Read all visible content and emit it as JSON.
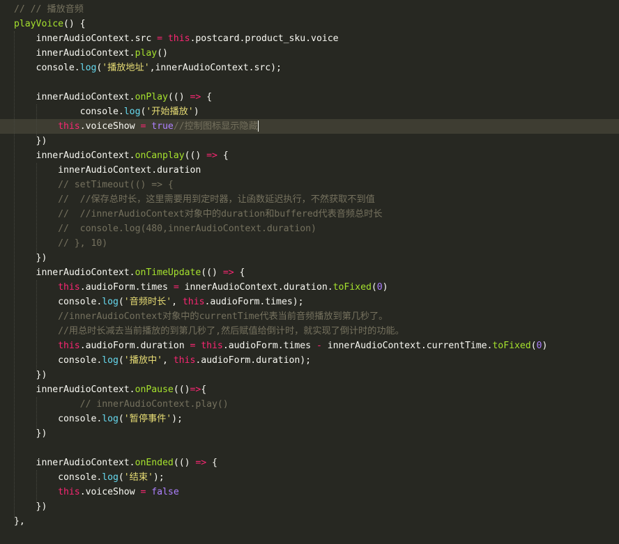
{
  "editor": {
    "cursor_after_line_index": 8,
    "highlighted_line_index": 8,
    "lines": [
      [
        [
          "cm",
          "// // 播放音频"
        ]
      ],
      [
        [
          "fn",
          "playVoice"
        ],
        [
          "pl",
          "() {"
        ]
      ],
      [
        [
          "pl",
          "    innerAudioContext.src "
        ],
        [
          "kw",
          "="
        ],
        [
          "pl",
          " "
        ],
        [
          "this",
          "this"
        ],
        [
          "pl",
          ".postcard.product_sku.voice"
        ]
      ],
      [
        [
          "pl",
          "    innerAudioContext."
        ],
        [
          "fn",
          "play"
        ],
        [
          "pl",
          "()"
        ]
      ],
      [
        [
          "pl",
          "    console."
        ],
        [
          "mt",
          "log"
        ],
        [
          "pl",
          "("
        ],
        [
          "st",
          "'播放地址'"
        ],
        [
          "pl",
          ",innerAudioContext.src);"
        ]
      ],
      [
        [
          "pl",
          ""
        ]
      ],
      [
        [
          "pl",
          "    innerAudioContext."
        ],
        [
          "fn",
          "onPlay"
        ],
        [
          "pl",
          "(() "
        ],
        [
          "kw",
          "=>"
        ],
        [
          "pl",
          " {"
        ]
      ],
      [
        [
          "pl",
          "            console."
        ],
        [
          "mt",
          "log"
        ],
        [
          "pl",
          "("
        ],
        [
          "st",
          "'开始播放'"
        ],
        [
          "pl",
          ")"
        ]
      ],
      [
        [
          "pl",
          "        "
        ],
        [
          "this",
          "this"
        ],
        [
          "pl",
          ".voiceShow "
        ],
        [
          "kw",
          "="
        ],
        [
          "pl",
          " "
        ],
        [
          "bo",
          "true"
        ],
        [
          "cm",
          "//控制图标显示隐藏"
        ]
      ],
      [
        [
          "pl",
          "    })"
        ]
      ],
      [
        [
          "pl",
          "    innerAudioContext."
        ],
        [
          "fn",
          "onCanplay"
        ],
        [
          "pl",
          "(() "
        ],
        [
          "kw",
          "=>"
        ],
        [
          "pl",
          " {"
        ]
      ],
      [
        [
          "pl",
          "        innerAudioContext.duration"
        ]
      ],
      [
        [
          "cm",
          "        // setTimeout(() => {"
        ]
      ],
      [
        [
          "cm",
          "        //  //保存总时长，这里需要用到定时器，让函数延迟执行，不然获取不到值"
        ]
      ],
      [
        [
          "cm",
          "        //  //innerAudioContext对象中的duration和buffered代表音频总时长"
        ]
      ],
      [
        [
          "cm",
          "        //  console.log(480,innerAudioContext.duration)"
        ]
      ],
      [
        [
          "cm",
          "        // }, 10)"
        ]
      ],
      [
        [
          "pl",
          "    })"
        ]
      ],
      [
        [
          "pl",
          "    innerAudioContext."
        ],
        [
          "fn",
          "onTimeUpdate"
        ],
        [
          "pl",
          "(() "
        ],
        [
          "kw",
          "=>"
        ],
        [
          "pl",
          " {"
        ]
      ],
      [
        [
          "pl",
          "        "
        ],
        [
          "this",
          "this"
        ],
        [
          "pl",
          ".audioForm.times "
        ],
        [
          "kw",
          "="
        ],
        [
          "pl",
          " innerAudioContext.duration."
        ],
        [
          "fn",
          "toFixed"
        ],
        [
          "pl",
          "("
        ],
        [
          "bo",
          "0"
        ],
        [
          "pl",
          ")"
        ]
      ],
      [
        [
          "pl",
          "        console."
        ],
        [
          "mt",
          "log"
        ],
        [
          "pl",
          "("
        ],
        [
          "st",
          "'音频时长'"
        ],
        [
          "pl",
          ", "
        ],
        [
          "this",
          "this"
        ],
        [
          "pl",
          ".audioForm.times);"
        ]
      ],
      [
        [
          "cm",
          "        //innerAudioContext对象中的currentTime代表当前音频播放到第几秒了。"
        ]
      ],
      [
        [
          "cm",
          "        //用总时长减去当前播放的到第几秒了,然后赋值给倒计时，就实现了倒计时的功能。"
        ]
      ],
      [
        [
          "pl",
          "        "
        ],
        [
          "this",
          "this"
        ],
        [
          "pl",
          ".audioForm.duration "
        ],
        [
          "kw",
          "="
        ],
        [
          "pl",
          " "
        ],
        [
          "this",
          "this"
        ],
        [
          "pl",
          ".audioForm.times "
        ],
        [
          "kw",
          "-"
        ],
        [
          "pl",
          " innerAudioContext.currentTime."
        ],
        [
          "fn",
          "toFixed"
        ],
        [
          "pl",
          "("
        ],
        [
          "bo",
          "0"
        ],
        [
          "pl",
          ")"
        ]
      ],
      [
        [
          "pl",
          "        console."
        ],
        [
          "mt",
          "log"
        ],
        [
          "pl",
          "("
        ],
        [
          "st",
          "'播放中'"
        ],
        [
          "pl",
          ", "
        ],
        [
          "this",
          "this"
        ],
        [
          "pl",
          ".audioForm.duration);"
        ]
      ],
      [
        [
          "pl",
          "    })"
        ]
      ],
      [
        [
          "pl",
          "    innerAudioContext."
        ],
        [
          "fn",
          "onPause"
        ],
        [
          "pl",
          "(()"
        ],
        [
          "kw",
          "=>"
        ],
        [
          "pl",
          "{"
        ]
      ],
      [
        [
          "cm",
          "            // innerAudioContext.play()"
        ]
      ],
      [
        [
          "pl",
          "        console."
        ],
        [
          "mt",
          "log"
        ],
        [
          "pl",
          "("
        ],
        [
          "st",
          "'暂停事件'"
        ],
        [
          "pl",
          ");"
        ]
      ],
      [
        [
          "pl",
          "    })"
        ]
      ],
      [
        [
          "pl",
          ""
        ]
      ],
      [
        [
          "pl",
          "    innerAudioContext."
        ],
        [
          "fn",
          "onEnded"
        ],
        [
          "pl",
          "(() "
        ],
        [
          "kw",
          "=>"
        ],
        [
          "pl",
          " {"
        ]
      ],
      [
        [
          "pl",
          "        console."
        ],
        [
          "mt",
          "log"
        ],
        [
          "pl",
          "("
        ],
        [
          "st",
          "'结束'"
        ],
        [
          "pl",
          ");"
        ]
      ],
      [
        [
          "pl",
          "        "
        ],
        [
          "this",
          "this"
        ],
        [
          "pl",
          ".voiceShow "
        ],
        [
          "kw",
          "="
        ],
        [
          "pl",
          " "
        ],
        [
          "bo",
          "false"
        ]
      ],
      [
        [
          "pl",
          "    })"
        ]
      ],
      [
        [
          "pl",
          "},"
        ]
      ]
    ]
  }
}
